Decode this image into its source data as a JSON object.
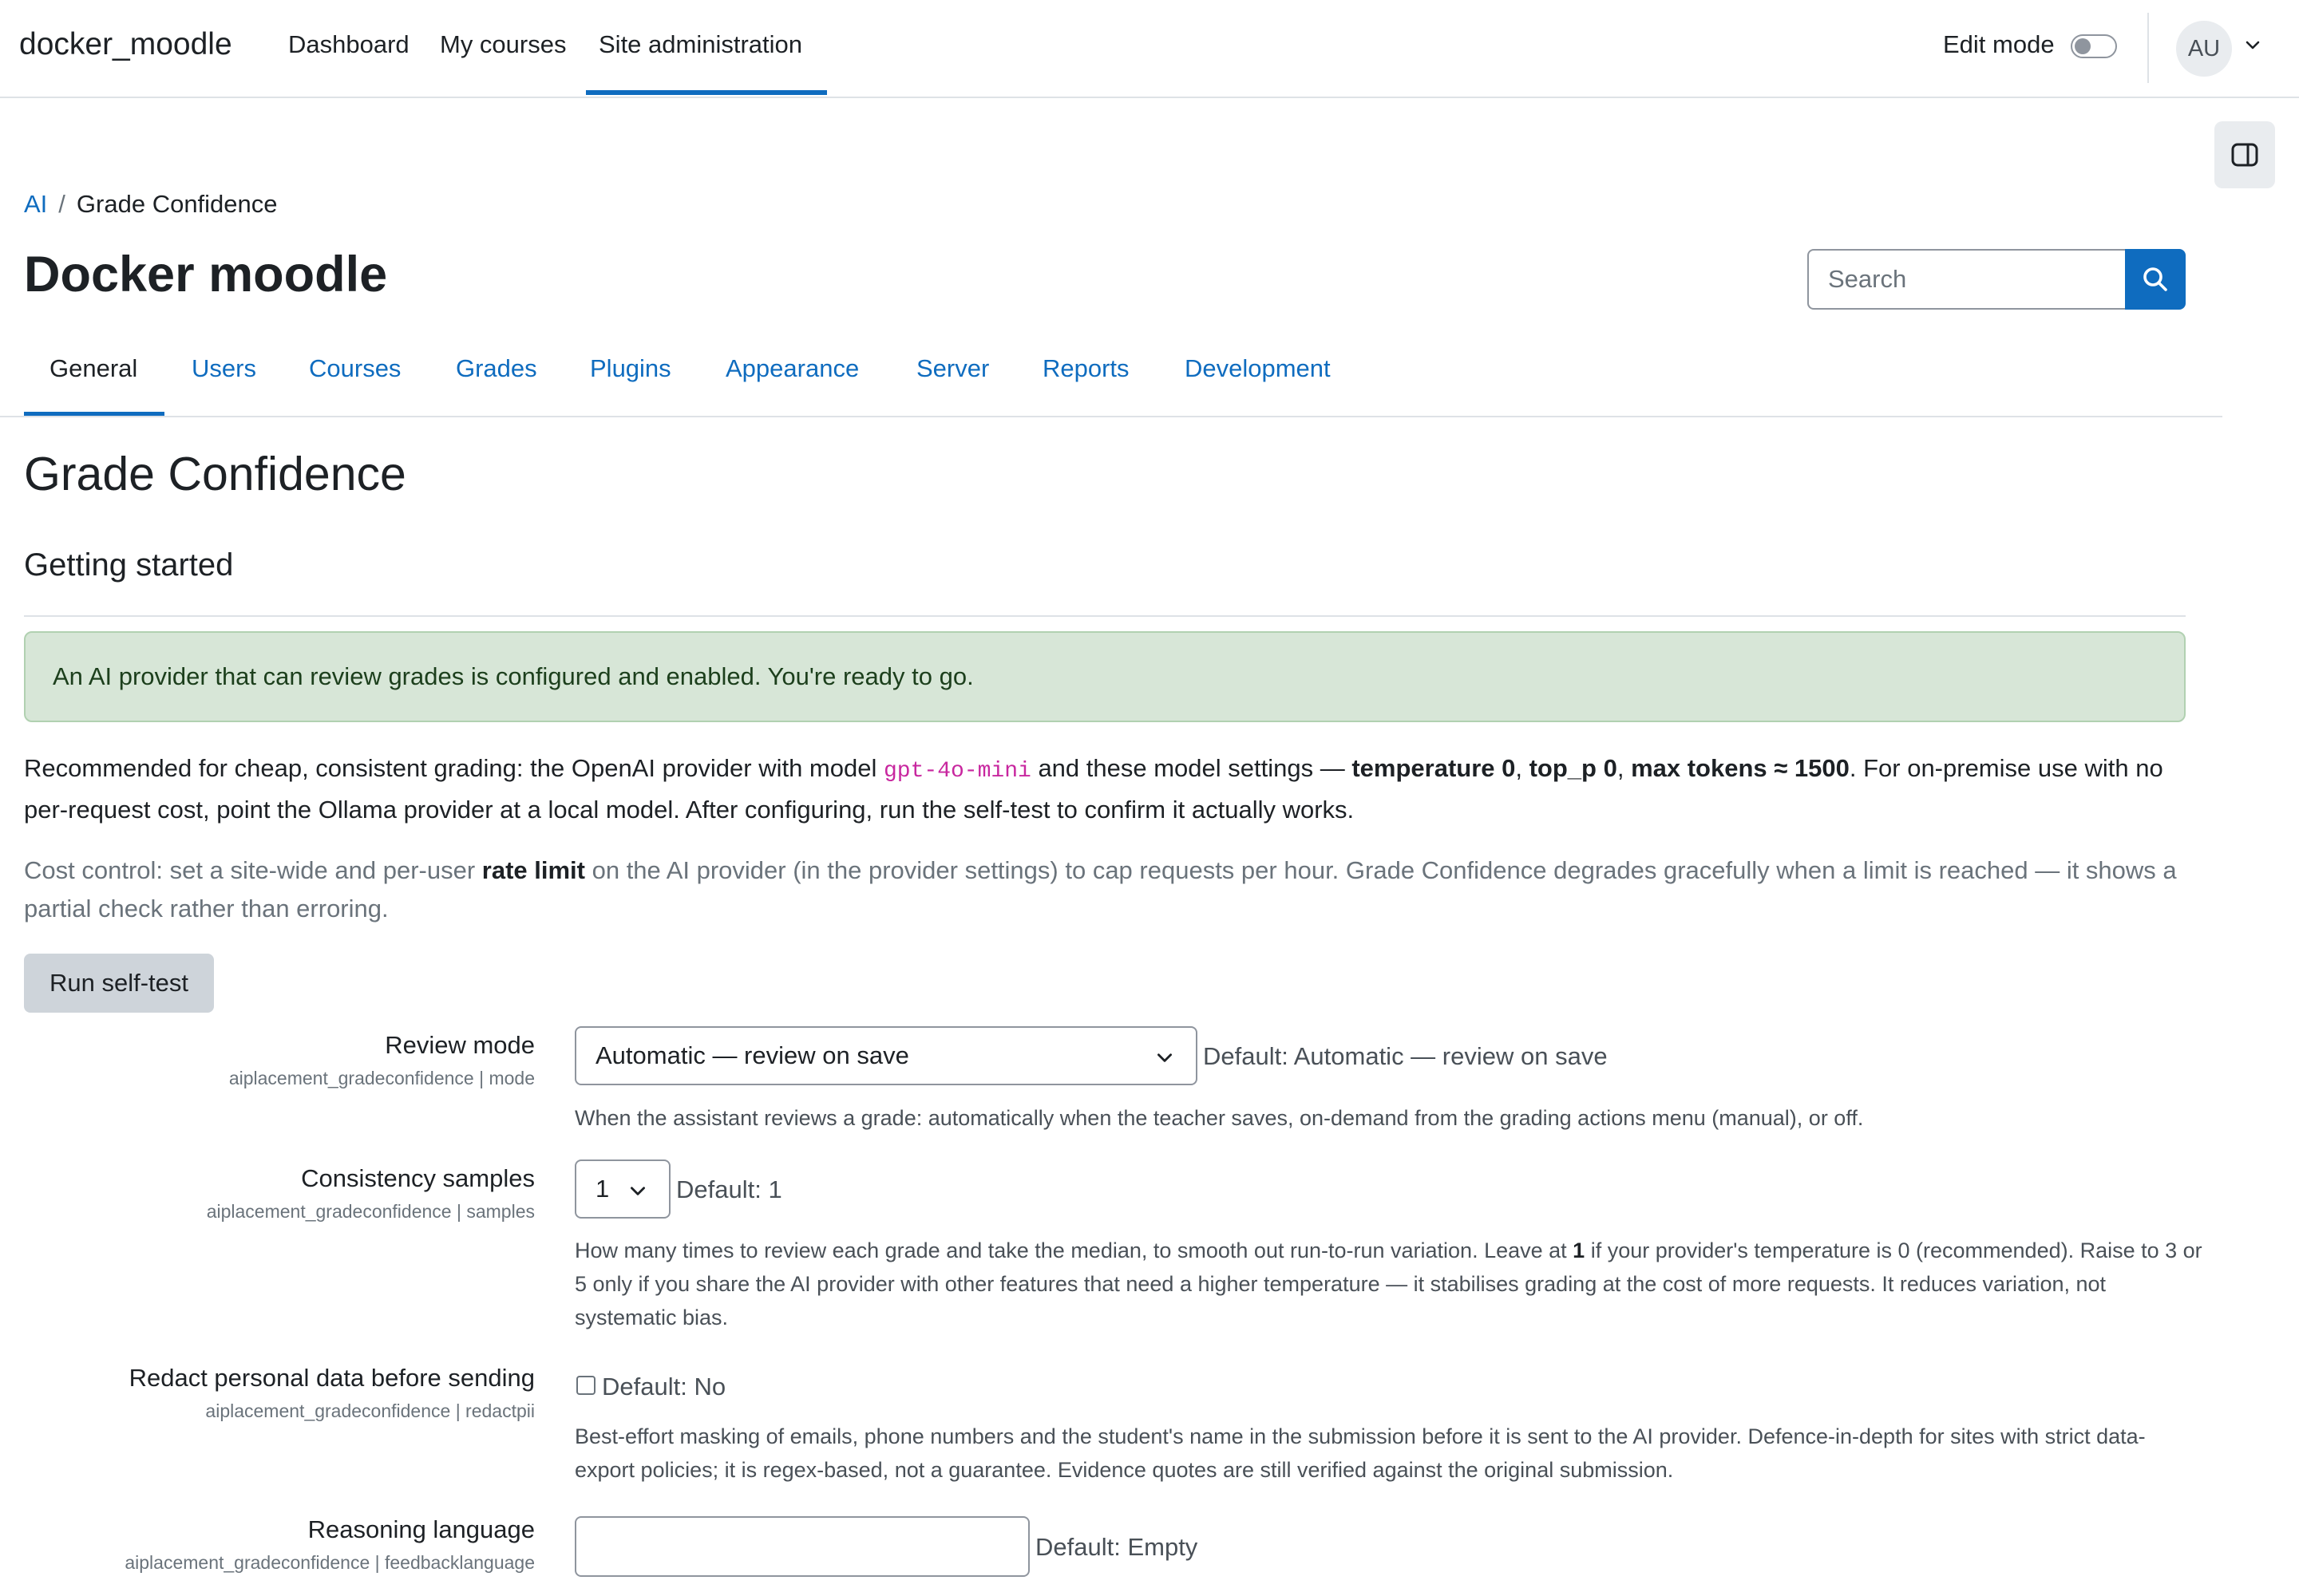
{
  "navbar": {
    "brand": "docker_moodle",
    "items": [
      "Dashboard",
      "My courses",
      "Site administration"
    ],
    "active_item": "Site administration",
    "edit_mode_label": "Edit mode",
    "edit_mode_on": false,
    "avatar_initials": "AU"
  },
  "breadcrumb": {
    "items": [
      "AI",
      "Grade Confidence"
    ]
  },
  "page_title": "Docker moodle",
  "search": {
    "placeholder": "Search"
  },
  "tabs": {
    "items": [
      "General",
      "Users",
      "Courses",
      "Grades",
      "Plugins",
      "Appearance",
      "Server",
      "Reports",
      "Development"
    ],
    "active": "General"
  },
  "section_title": "Grade Confidence",
  "subsection_title": "Getting started",
  "alert_text": "An AI provider that can review grades is configured and enabled. You're ready to go.",
  "recommendation": {
    "p1": "Recommended for cheap, consistent grading: the OpenAI provider with model ",
    "model": "gpt-4o-mini",
    "p2": " and these model settings — ",
    "temperature": "temperature 0",
    "comma1": ", ",
    "top_p": "top_p 0",
    "comma2": ", ",
    "max_tokens": "max tokens ≈ 1500",
    "p3": ". For on-premise use with no per-request cost, point the Ollama provider at a local model. After configuring, run the self-test to confirm it actually works."
  },
  "cost_control": {
    "p1": "Cost control: set a site-wide and per-user ",
    "rate_limit": "rate limit",
    "p2": " on the AI provider (in the provider settings) to cap requests per hour. Grade Confidence degrades gracefully when a limit is reached — it shows a partial check rather than erroring."
  },
  "self_test_button": "Run self-test",
  "settings": {
    "review_mode": {
      "label": "Review mode",
      "key": "aiplacement_gradeconfidence | mode",
      "value": "Automatic — review on save",
      "default": "Default: Automatic — review on save",
      "description": "When the assistant reviews a grade: automatically when the teacher saves, on-demand from the grading actions menu (manual), or off."
    },
    "samples": {
      "label": "Consistency samples",
      "key": "aiplacement_gradeconfidence | samples",
      "value": "1",
      "default": "Default: 1",
      "desc_p1": "How many times to review each grade and take the median, to smooth out run-to-run variation. Leave at ",
      "desc_bold": "1",
      "desc_p2": " if your provider's temperature is 0 (recommended). Raise to 3 or 5 only if you share the AI provider with other features that need a higher temperature — it stabilises grading at the cost of more requests. It reduces variation, not systematic bias."
    },
    "redact": {
      "label": "Redact personal data before sending",
      "key": "aiplacement_gradeconfidence | redactpii",
      "checked": false,
      "default": "Default: No",
      "description": "Best-effort masking of emails, phone numbers and the student's name in the submission before it is sent to the AI provider. Defence-in-depth for sites with strict data-export policies; it is regex-based, not a guarantee. Evidence quotes are still verified against the original submission."
    },
    "language": {
      "label": "Reasoning language",
      "key": "aiplacement_gradeconfidence | feedbacklanguage",
      "value": "",
      "default": "Default: Empty"
    }
  },
  "colors": {
    "primary": "#0f6cbf",
    "alert_bg": "#d7e6d7",
    "code": "#c8279f",
    "button_secondary": "#ced4da"
  }
}
